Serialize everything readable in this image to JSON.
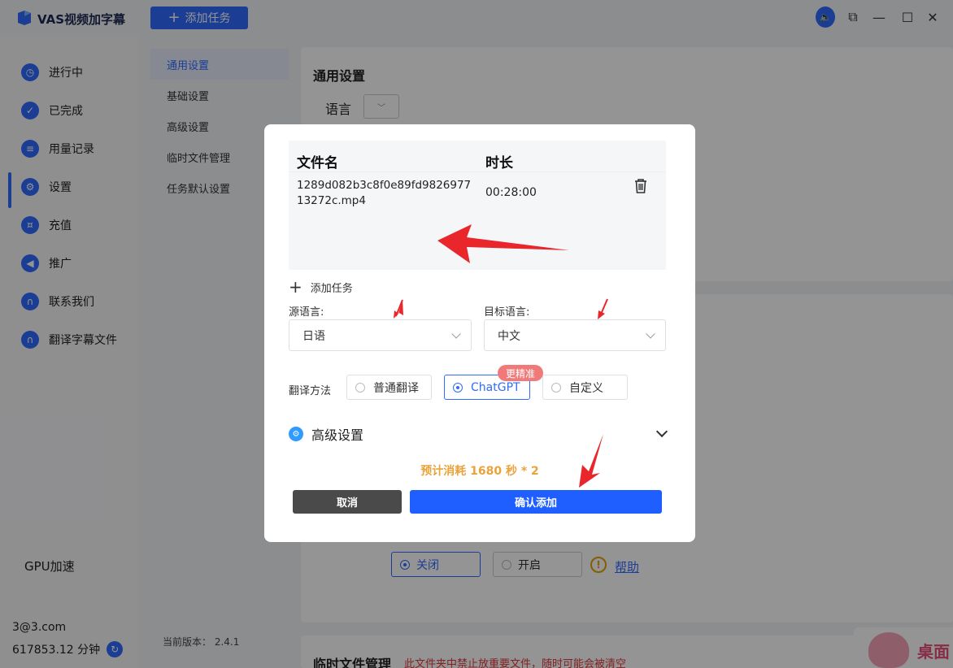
{
  "app": {
    "title": "VAS视频加字幕",
    "add_task_label": "添加任务",
    "version": "当前版本：  2.4.1"
  },
  "sidebar": {
    "items": [
      {
        "label": "进行中",
        "icon": "clock-icon"
      },
      {
        "label": "已完成",
        "icon": "check-icon"
      },
      {
        "label": "用量记录",
        "icon": "list-icon"
      },
      {
        "label": "设置",
        "icon": "gear-icon"
      },
      {
        "label": "充值",
        "icon": "coins-icon"
      },
      {
        "label": "推广",
        "icon": "megaphone-icon"
      },
      {
        "label": "联系我们",
        "icon": "headset-icon"
      },
      {
        "label": "翻译字幕文件",
        "icon": "headset-icon"
      }
    ],
    "active_index": 3,
    "account": "3@3.com",
    "balance": "617853.12 分钟"
  },
  "settings_nav": {
    "items": [
      "通用设置",
      "基础设置",
      "高级设置",
      "临时文件管理",
      "任务默认设置"
    ],
    "active_index": 0
  },
  "settings": {
    "general_title": "通用设置",
    "language_label": "语言",
    "gpu_label": "GPU加速",
    "gpu_off": "关闭",
    "gpu_on": "开启",
    "help": "帮助",
    "temp_title": "临时文件管理",
    "temp_warning": "此文件夹中禁止放重要文件，随时可能会被清空"
  },
  "watermark": {
    "text": "桌面"
  },
  "modal": {
    "table": {
      "col_name": "文件名",
      "col_duration": "时长",
      "rows": [
        {
          "name": "1289d082b3c8f0e89fd982697713272c.mp4",
          "duration": "00:28:00"
        }
      ]
    },
    "add_task": "添加任务",
    "source_label": "源语言:",
    "source_value": "日语",
    "target_label": "目标语言:",
    "target_value": "中文",
    "method_label": "翻译方法",
    "methods": [
      {
        "label": "普通翻译",
        "selected": false
      },
      {
        "label": "ChatGPT",
        "selected": true
      },
      {
        "label": "自定义",
        "selected": false
      }
    ],
    "badge": "更精准",
    "advanced": "高级设置",
    "estimate": "预计消耗 1680 秒 * 2",
    "cancel": "取消",
    "confirm": "确认添加"
  },
  "colors": {
    "primary": "#2f6bff",
    "confirm": "#1f5fff",
    "cancel": "#4a4a4a",
    "estimate": "#e8a33a",
    "badge": "#f07a7a",
    "annotation_arrow": "#e8262b"
  }
}
